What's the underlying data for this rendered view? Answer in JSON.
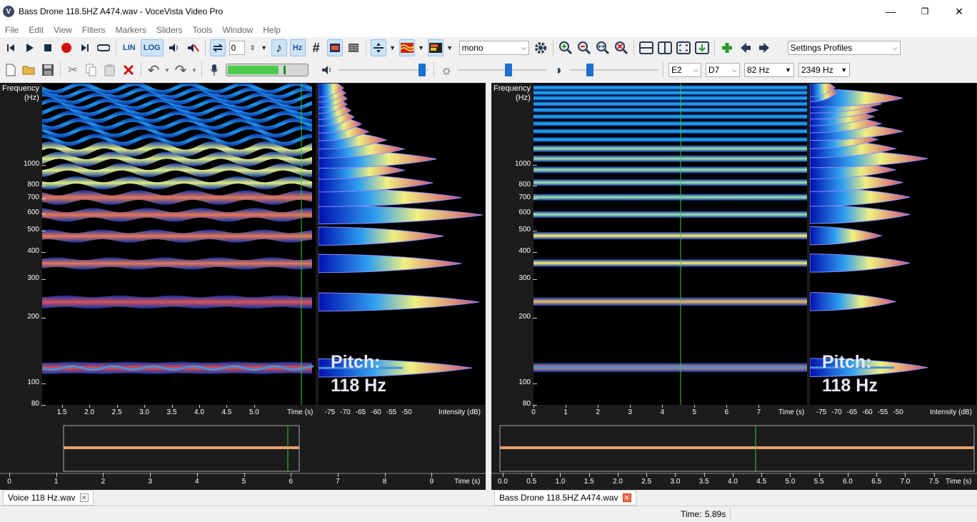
{
  "window": {
    "title": "Bass Drone 118.5HZ A474.wav - VoceVista Video Pro",
    "minimize": "—",
    "restore": "❐",
    "close": "✕"
  },
  "menu": [
    "File",
    "Edit",
    "View",
    "Filters",
    "Markers",
    "Sliders",
    "Tools",
    "Window",
    "Help"
  ],
  "toolbar1": {
    "lin_label": "LIN",
    "log_label": "LOG",
    "hz_label": "Hz",
    "sharp_label": "#",
    "loop_value": "0",
    "channel_value": "mono",
    "profiles_value": "Settings Profiles"
  },
  "toolbar2": {
    "low_note": "E2",
    "high_note": "D7",
    "low_freq": "82 Hz",
    "high_freq": "2349 Hz",
    "input_level": 0.63
  },
  "icons": [
    "skip-start-icon",
    "play-icon",
    "stop-icon",
    "record-icon",
    "skip-end-icon",
    "loop-icon",
    "speaker-icon",
    "mute-icon",
    "repeat-icon",
    "note-icon",
    "spectrogram-icon",
    "list-icon",
    "zoom-vertical-icon",
    "waveform-color-icon",
    "palette-icon",
    "gear-icon",
    "zoom-in-icon",
    "zoom-out-icon",
    "zoom-fit-icon",
    "zoom-reset-icon",
    "horizontal-split-icon",
    "vertical-split-icon",
    "fullscreen-icon",
    "download-icon",
    "add-icon",
    "back-arrow-icon",
    "forward-arrow-icon",
    "new-file-icon",
    "open-folder-icon",
    "save-icon",
    "cut-icon",
    "copy-icon",
    "paste-icon",
    "delete-icon",
    "undo-icon",
    "redo-icon",
    "microphone-icon",
    "volume-icon",
    "brightness-icon",
    "contrast-icon"
  ],
  "colors": {
    "accent": "#1e6fcf",
    "pitch_track": "#4a90d9",
    "cursor": "#2fd02f",
    "waveform": "#e8a070"
  },
  "spectrogram": {
    "freq_label_line1": "Frequency",
    "freq_label_line2": "(Hz)",
    "y_ticks": [
      "1000",
      "800",
      "700",
      "600",
      "500",
      "400",
      "300",
      "200",
      "100",
      "80"
    ],
    "time_label": "Time (s)",
    "intensity_label": "Intensity (dB)",
    "db_ticks": [
      "-75",
      "-70",
      "-65",
      "-60",
      "-55",
      "-50"
    ],
    "pitch_line1": "Pitch:",
    "pitch_line2": "118 Hz"
  },
  "left": {
    "x_ticks": [
      "1.5",
      "2.0",
      "2.5",
      "3.0",
      "3.5",
      "4.0",
      "4.5",
      "5.0"
    ],
    "wave_ticks": [
      "0",
      "1",
      "2",
      "3",
      "4",
      "5",
      "6",
      "7",
      "8",
      "9"
    ],
    "wave_time_label": "Time (s)",
    "tab": "Voice 118 Hz.wav"
  },
  "right": {
    "x_ticks": [
      "0",
      "1",
      "2",
      "3",
      "4",
      "5",
      "6",
      "7"
    ],
    "wave_ticks": [
      "0.0",
      "0.5",
      "1.0",
      "1.5",
      "2.0",
      "2.5",
      "3.0",
      "3.5",
      "4.0",
      "4.5",
      "5.0",
      "5.5",
      "6.0",
      "6.5",
      "7.0",
      "7.5"
    ],
    "wave_time_label": "Time (s)",
    "tab": "Bass Drone 118.5HZ A474.wav"
  },
  "status": {
    "time_label": "Time:",
    "time_value": "5.89s"
  }
}
